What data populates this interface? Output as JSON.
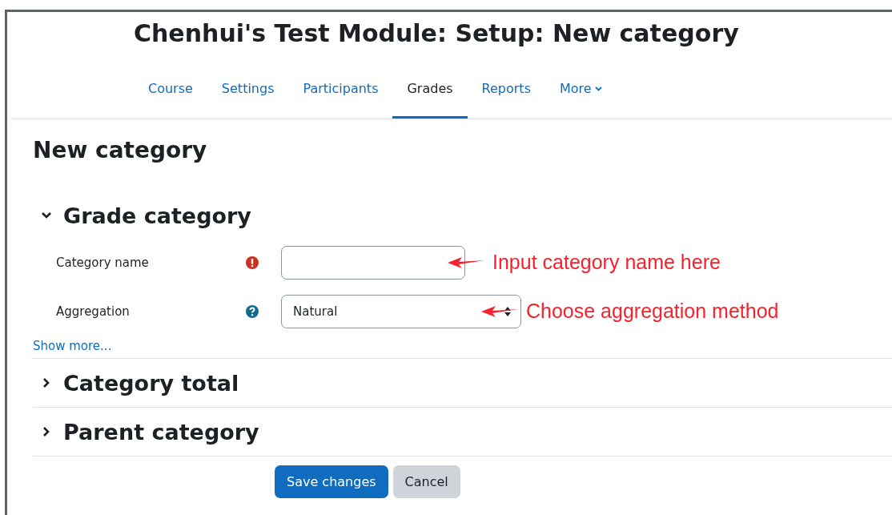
{
  "page_title": "Chenhui's Test Module: Setup: New category",
  "nav": [
    {
      "label": "Course",
      "selected": false
    },
    {
      "label": "Settings",
      "selected": false
    },
    {
      "label": "Participants",
      "selected": false
    },
    {
      "label": "Grades",
      "selected": true
    },
    {
      "label": "Reports",
      "selected": false
    },
    {
      "label": "More",
      "selected": false,
      "kind": "dropdown"
    }
  ],
  "heading": "New category",
  "sections": [
    {
      "title": "Grade category",
      "expanded": true,
      "fields": [
        {
          "label": "Category name",
          "kind": "text",
          "required": true,
          "help": false,
          "annotation": "Input category name here"
        },
        {
          "label": "Aggregation",
          "kind": "select",
          "required": false,
          "help": true,
          "value": "Natural",
          "annotation": "Choose aggregation method"
        }
      ],
      "show_more": "Show more..."
    },
    {
      "title": "Category total",
      "expanded": false
    },
    {
      "title": "Parent category",
      "expanded": false
    }
  ],
  "buttons": [
    {
      "label": "Save changes",
      "kind": "primary"
    },
    {
      "label": "Cancel",
      "kind": "secondary"
    }
  ]
}
